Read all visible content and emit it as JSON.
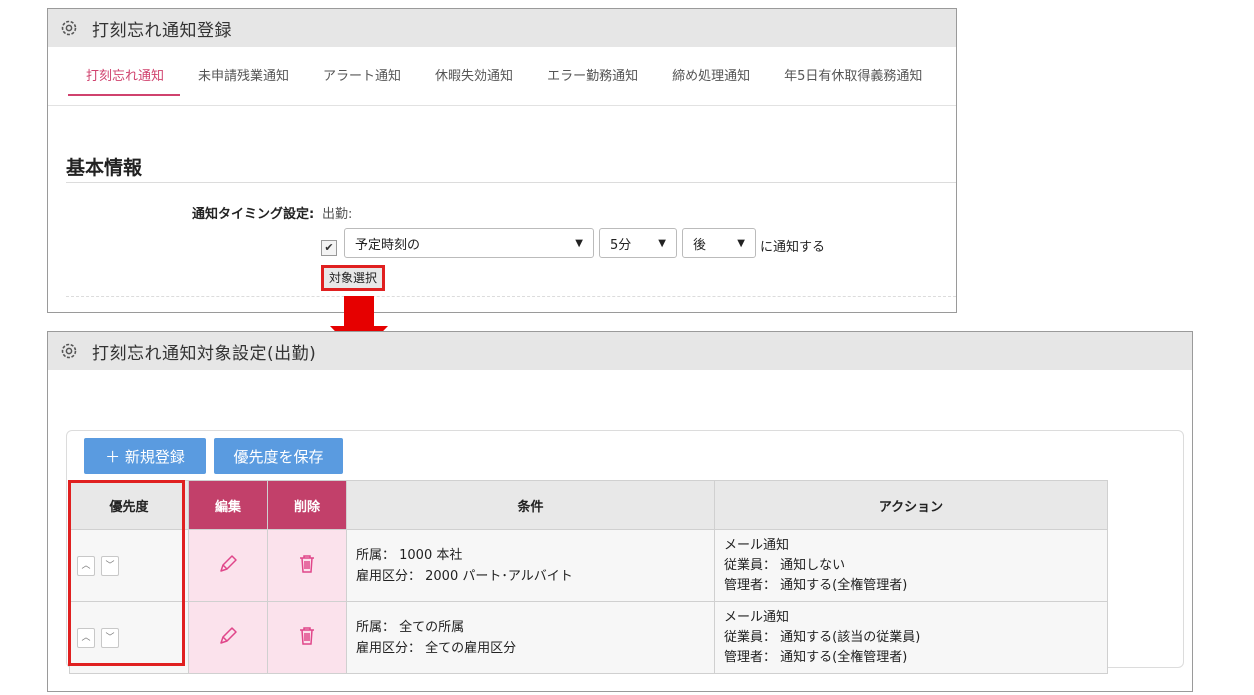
{
  "panel1": {
    "title": "打刻忘れ通知登録",
    "icon": "gear-icon",
    "tabs": [
      {
        "label": "打刻忘れ通知",
        "active": true
      },
      {
        "label": "未申請残業通知",
        "active": false
      },
      {
        "label": "アラート通知",
        "active": false
      },
      {
        "label": "休暇失効通知",
        "active": false
      },
      {
        "label": "エラー勤務通知",
        "active": false
      },
      {
        "label": "締め処理通知",
        "active": false
      },
      {
        "label": "年5日有休取得義務通知",
        "active": false
      }
    ],
    "section_title": "基本情報",
    "timing_label": "通知タイミング設定:",
    "timing_sub": "出勤:",
    "checkbox_checked": true,
    "select_base": "予定時刻の",
    "select_minutes": "5分",
    "select_direction": "後",
    "notify_suffix": "に通知する",
    "target_button": "対象選択"
  },
  "panel2": {
    "title": "打刻忘れ通知対象設定(出勤)",
    "icon": "gear-icon",
    "new_button": "＋ 新規登録",
    "save_priority_button": "優先度を保存",
    "columns": {
      "priority": "優先度",
      "edit": "編集",
      "delete": "削除",
      "condition": "条件",
      "action": "アクション"
    },
    "rows": [
      {
        "cond1": "所属： 1000 本社",
        "cond2": "雇用区分： 2000 パート･アルバイト",
        "act1": "メール通知",
        "act2": "従業員： 通知しない",
        "act3": "管理者： 通知する(全権管理者)"
      },
      {
        "cond1": "所属： 全ての所属",
        "cond2": "雇用区分： 全ての雇用区分",
        "act1": "メール通知",
        "act2": "従業員： 通知する(該当の従業員)",
        "act3": "管理者： 通知する(全権管理者)"
      }
    ]
  },
  "colors": {
    "accent_pink": "#c2406a",
    "tab_active": "#d0426e",
    "button_blue": "#5a9be0",
    "highlight_red": "#e02020"
  }
}
